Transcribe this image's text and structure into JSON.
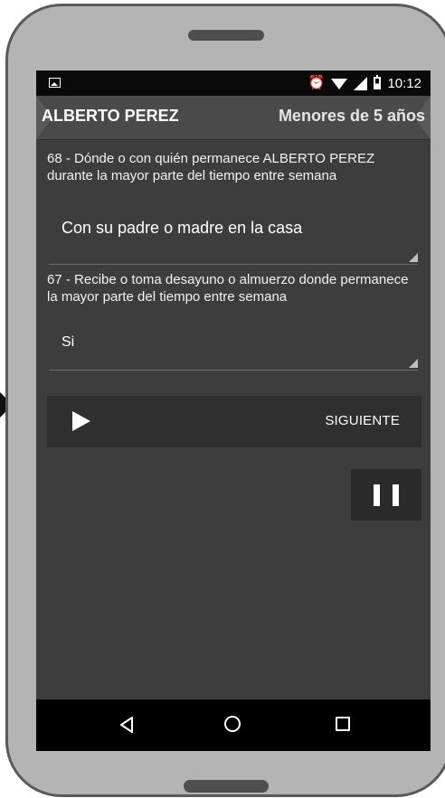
{
  "status_bar": {
    "time": "10:12",
    "icons": [
      "image-icon",
      "alarm-icon",
      "wifi-icon",
      "signal-icon",
      "battery-icon"
    ]
  },
  "header": {
    "title": "ALBERTO PEREZ",
    "subtitle": "Menores de 5 años"
  },
  "questions": [
    {
      "text": "68 - Dónde o con quién permanece ALBERTO PEREZ durante la mayor parte del tiempo entre semana",
      "answer": "Con su padre o madre en la casa"
    },
    {
      "text": "67 - Recibe o toma desayuno o almuerzo donde permanece la mayor parte del tiempo entre semana",
      "answer": "Si"
    }
  ],
  "navigation": {
    "next_label": "SIGUIENTE",
    "play_icon": "play-icon",
    "pause_icon": "pause-icon"
  },
  "system_nav": {
    "icons": [
      "back-icon",
      "home-icon",
      "recent-apps-icon"
    ]
  },
  "colors": {
    "phone_body": "#b4b4b4",
    "screen_bg": "#3d3d3d",
    "header_bg": "#4a4a4a",
    "nav_bar_bg": "#2f2f2f"
  }
}
